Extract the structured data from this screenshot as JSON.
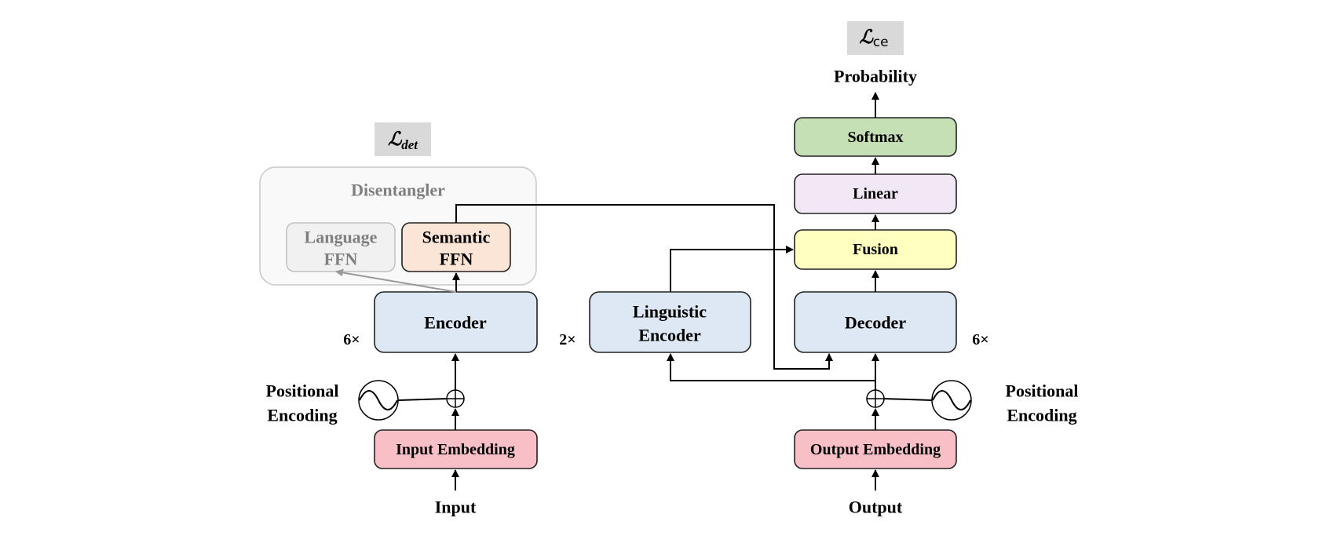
{
  "losses": {
    "det": {
      "symbol": "ℒ",
      "subscript": "det"
    },
    "ce": {
      "symbol": "ℒ",
      "subscript": "ce"
    }
  },
  "disentangler": {
    "title": "Disentangler",
    "language_ffn": [
      "Language",
      "FFN"
    ],
    "semantic_ffn": [
      "Semantic",
      "FFN"
    ]
  },
  "encoder": {
    "label": "Encoder",
    "repeat": "6×"
  },
  "linguistic_encoder": {
    "label": [
      "Linguistic",
      "Encoder"
    ],
    "repeat": "2×"
  },
  "decoder": {
    "label": "Decoder",
    "repeat": "6×"
  },
  "output_head": {
    "fusion": "Fusion",
    "linear": "Linear",
    "softmax": "Softmax",
    "probability": "Probability"
  },
  "input_side": {
    "embedding": "Input Embedding",
    "input": "Input",
    "positional_encoding": [
      "Positional",
      "Encoding"
    ]
  },
  "output_side": {
    "embedding": "Output Embedding",
    "output": "Output",
    "positional_encoding": [
      "Positional",
      "Encoding"
    ]
  },
  "colors": {
    "encoder": "#dde8f4",
    "embedding": "#f8bfc7",
    "softmax": "#c5e0b4",
    "linear": "#f2e7f5",
    "fusion": "#ffffbf",
    "semantic_ffn": "#fbe5d6",
    "language_ffn": "#f1f1f1",
    "loss_box": "#d9d9d9"
  }
}
